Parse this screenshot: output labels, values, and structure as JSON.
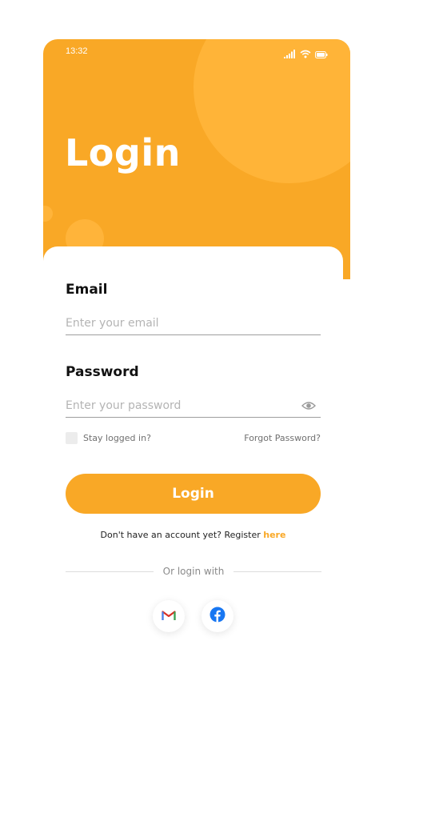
{
  "status_bar": {
    "time": "13:32",
    "icons": [
      "signal-icon",
      "wifi-icon",
      "battery-icon"
    ]
  },
  "header": {
    "title": "Login"
  },
  "form": {
    "email": {
      "label": "Email",
      "placeholder": "Enter your email",
      "value": ""
    },
    "password": {
      "label": "Password",
      "placeholder": "Enter your password",
      "value": "",
      "toggle_icon": "eye-icon"
    },
    "remember_label": "Stay logged in?",
    "forgot_label": "Forgot Password?",
    "submit_label": "Login"
  },
  "register": {
    "prompt": "Don't have an account yet? Register ",
    "link": "here"
  },
  "divider_text": "Or login with",
  "social": [
    {
      "icon": "gmail-icon"
    },
    {
      "icon": "facebook-icon"
    }
  ],
  "colors": {
    "accent": "#F9A826",
    "circle": "#FFB438",
    "facebook": "#1877F2",
    "gmail": "#D93025"
  }
}
